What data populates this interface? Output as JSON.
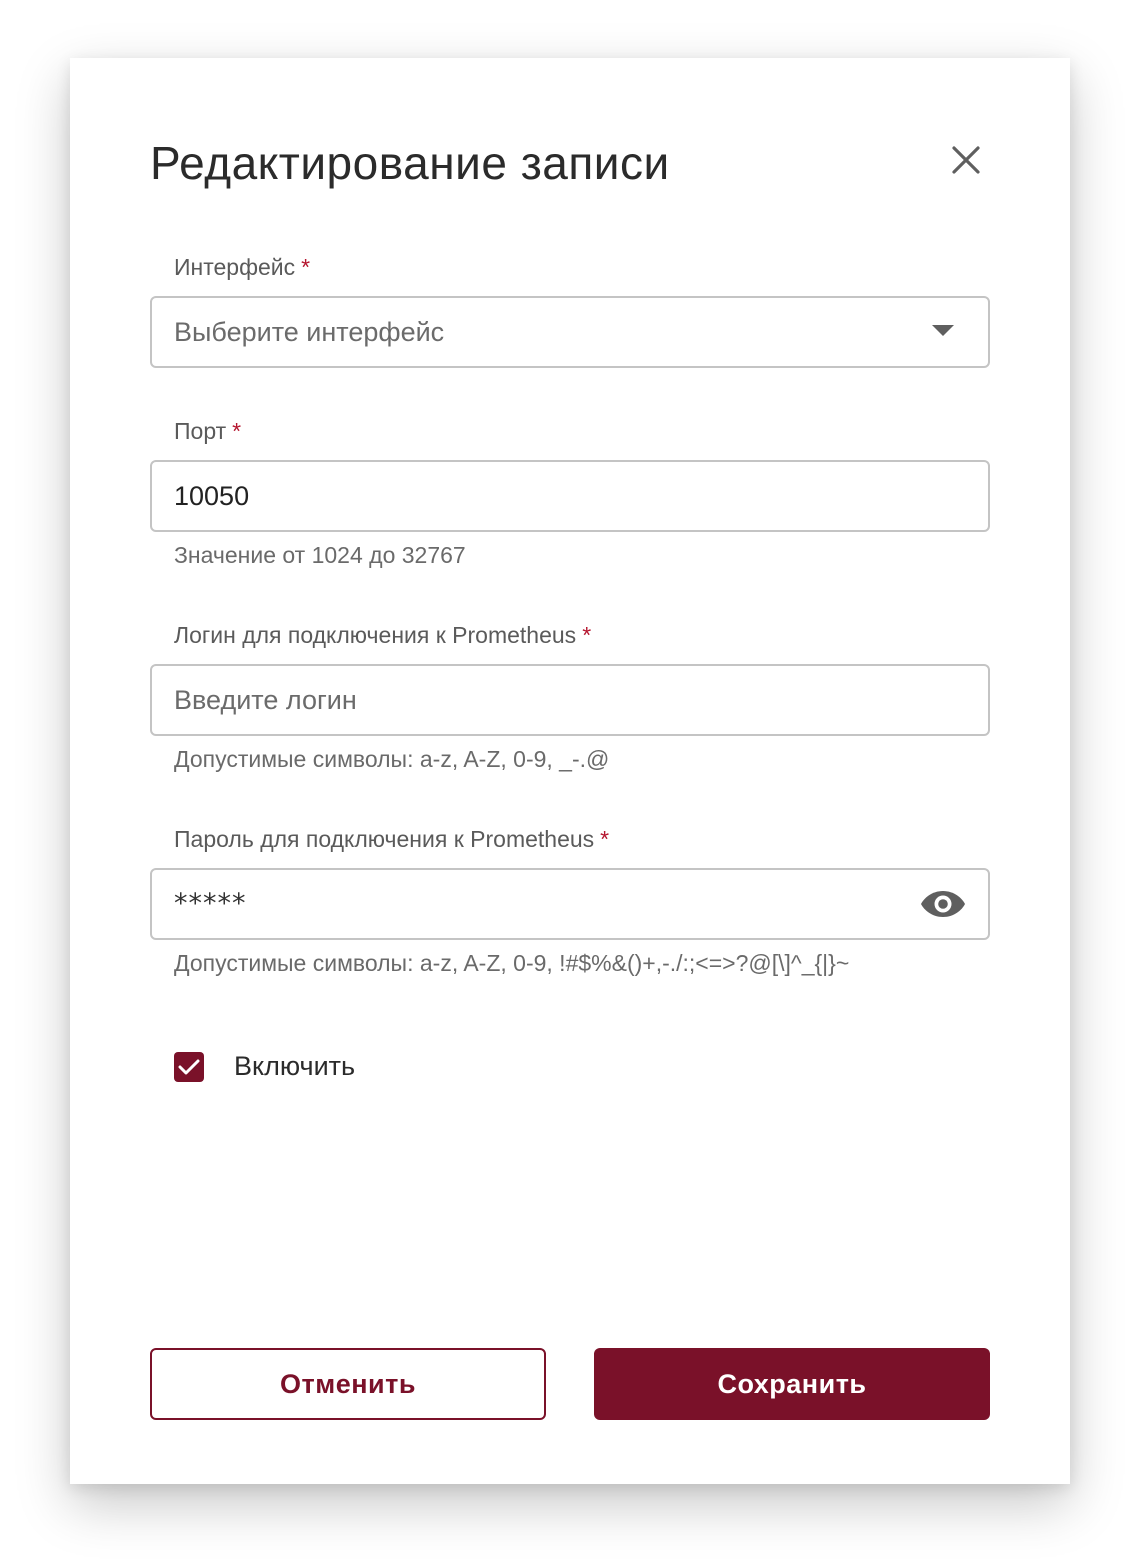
{
  "dialog": {
    "title": "Редактирование записи",
    "close_icon": "close-icon"
  },
  "interface": {
    "label": "Интерфейс",
    "required_mark": "*",
    "placeholder": "Выберите интерфейс",
    "icon": "chevron-down-icon"
  },
  "port": {
    "label": "Порт",
    "required_mark": "*",
    "value": "10050",
    "hint": "Значение от 1024 до 32767"
  },
  "login": {
    "label": "Логин для подключения к Prometheus",
    "required_mark": "*",
    "placeholder": "Введите логин",
    "hint": "Допустимые символы: a-z, A-Z, 0-9, _-.@"
  },
  "password": {
    "label": "Пароль для подключения к Prometheus",
    "required_mark": "*",
    "value": "*****",
    "hint": "Допустимые символы: a-z, A-Z, 0-9, !#$%&()+,-./:;<=>?@[\\]^_{|}~",
    "icon": "eye-icon"
  },
  "enable": {
    "label": "Включить",
    "checked": true
  },
  "actions": {
    "cancel_label": "Отменить",
    "save_label": "Сохранить"
  },
  "colors": {
    "accent": "#7a1129",
    "required": "#b5162f",
    "border": "#c4c4c4"
  }
}
